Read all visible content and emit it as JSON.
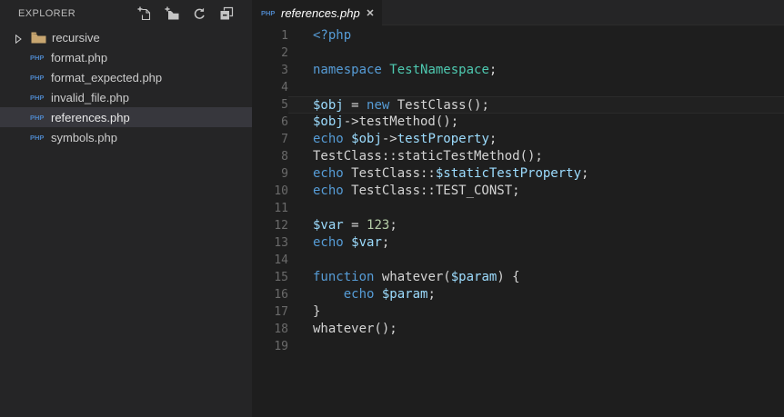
{
  "colors": {
    "keyword": "#569cd6",
    "variable": "#9cdcfe",
    "type": "#4ec9b0",
    "number": "#b5cea8",
    "plain": "#d4d4d4",
    "php_badge": "#4d84c4",
    "folder_icon": "#c8a670",
    "icon_gray": "#c5c5c5",
    "sidebar_bg": "#252526",
    "editor_bg": "#1e1e1e",
    "selection_bg": "#37373d"
  },
  "sidebar": {
    "title": "EXPLORER",
    "action_icons": [
      "new-file-icon",
      "new-folder-icon",
      "refresh-icon",
      "collapse-all-icon"
    ],
    "file_badge": "PHP",
    "tree": {
      "folder": {
        "label": "recursive",
        "expanded": false
      },
      "files": [
        {
          "label": "format.php",
          "selected": false
        },
        {
          "label": "format_expected.php",
          "selected": false
        },
        {
          "label": "invalid_file.php",
          "selected": false
        },
        {
          "label": "references.php",
          "selected": true
        },
        {
          "label": "symbols.php",
          "selected": false
        }
      ]
    }
  },
  "tabbar": {
    "tabs": [
      {
        "badge": "PHP",
        "title": "references.php",
        "close": "✕",
        "active": true,
        "preview": true
      }
    ]
  },
  "editor": {
    "language": "php",
    "lines": [
      {
        "num": "1",
        "tokens": [
          [
            "k",
            "<?php"
          ]
        ]
      },
      {
        "num": "2",
        "tokens": []
      },
      {
        "num": "3",
        "tokens": [
          [
            "k",
            "namespace"
          ],
          [
            "p",
            " "
          ],
          [
            "t",
            "TestNamespace"
          ],
          [
            "p",
            ";"
          ]
        ]
      },
      {
        "num": "4",
        "tokens": []
      },
      {
        "num": "5",
        "tokens": [
          [
            "v",
            "$obj"
          ],
          [
            "p",
            " = "
          ],
          [
            "k",
            "new"
          ],
          [
            "p",
            " TestClass();"
          ]
        ],
        "highlight": true
      },
      {
        "num": "6",
        "tokens": [
          [
            "v",
            "$obj"
          ],
          [
            "p",
            "->testMethod();"
          ]
        ]
      },
      {
        "num": "7",
        "tokens": [
          [
            "k",
            "echo"
          ],
          [
            "p",
            " "
          ],
          [
            "v",
            "$obj"
          ],
          [
            "p",
            "->"
          ],
          [
            "v",
            "testProperty"
          ],
          [
            "p",
            ";"
          ]
        ]
      },
      {
        "num": "8",
        "tokens": [
          [
            "p",
            "TestClass::staticTestMethod();"
          ]
        ]
      },
      {
        "num": "9",
        "tokens": [
          [
            "k",
            "echo"
          ],
          [
            "p",
            " TestClass::"
          ],
          [
            "v",
            "$staticTestProperty"
          ],
          [
            "p",
            ";"
          ]
        ]
      },
      {
        "num": "10",
        "tokens": [
          [
            "k",
            "echo"
          ],
          [
            "p",
            " TestClass::TEST_CONST;"
          ]
        ]
      },
      {
        "num": "11",
        "tokens": []
      },
      {
        "num": "12",
        "tokens": [
          [
            "v",
            "$var"
          ],
          [
            "p",
            " = "
          ],
          [
            "n",
            "123"
          ],
          [
            "p",
            ";"
          ]
        ]
      },
      {
        "num": "13",
        "tokens": [
          [
            "k",
            "echo"
          ],
          [
            "p",
            " "
          ],
          [
            "v",
            "$var"
          ],
          [
            "p",
            ";"
          ]
        ]
      },
      {
        "num": "14",
        "tokens": []
      },
      {
        "num": "15",
        "tokens": [
          [
            "k",
            "function"
          ],
          [
            "p",
            " whatever("
          ],
          [
            "v",
            "$param"
          ],
          [
            "p",
            ") {"
          ]
        ]
      },
      {
        "num": "16",
        "tokens": [
          [
            "p",
            "    "
          ],
          [
            "k",
            "echo"
          ],
          [
            "p",
            " "
          ],
          [
            "v",
            "$param"
          ],
          [
            "p",
            ";"
          ]
        ]
      },
      {
        "num": "17",
        "tokens": [
          [
            "p",
            "}"
          ]
        ]
      },
      {
        "num": "18",
        "tokens": [
          [
            "p",
            "whatever();"
          ]
        ]
      },
      {
        "num": "19",
        "tokens": []
      }
    ]
  }
}
